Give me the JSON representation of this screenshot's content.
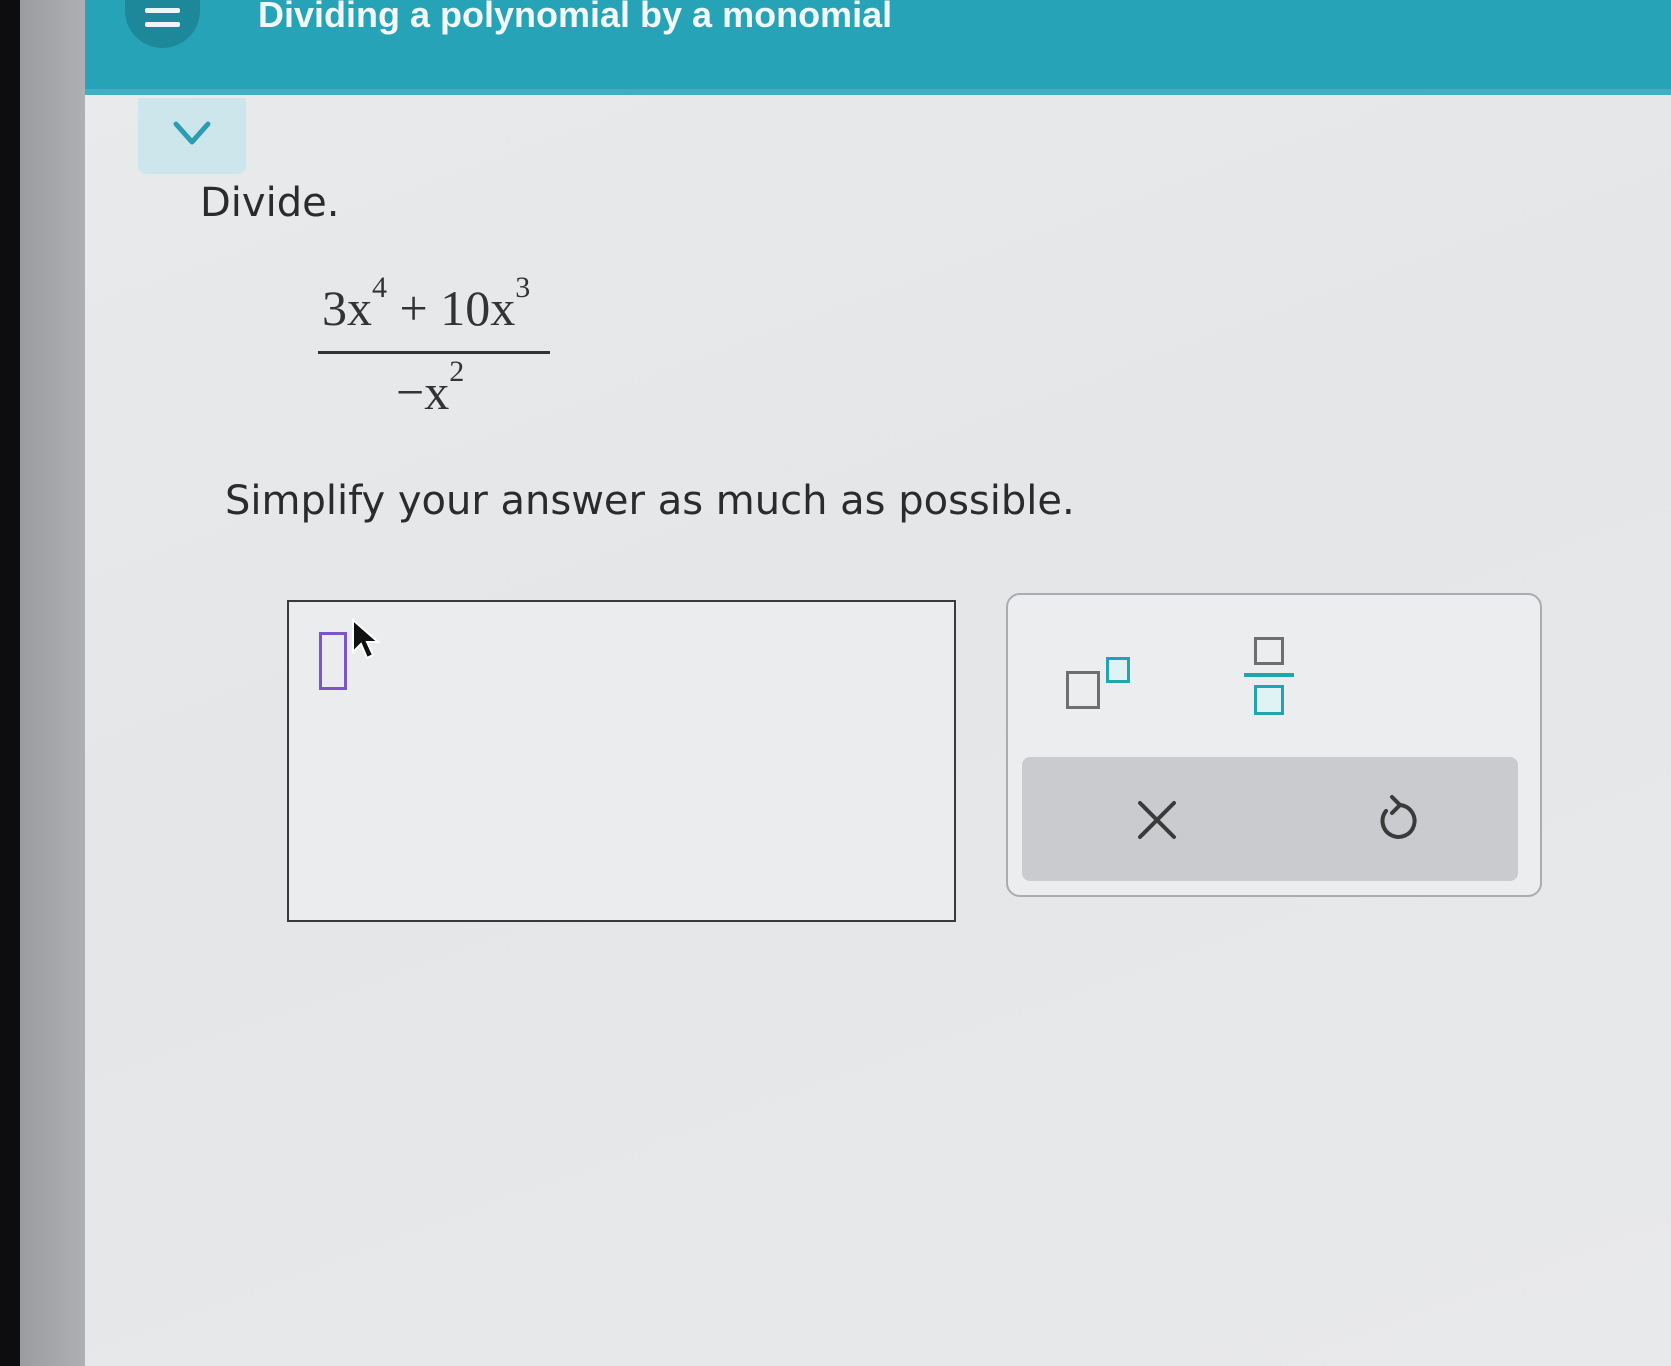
{
  "header": {
    "title": "Dividing a polynomial by a monomial"
  },
  "question": {
    "prompt": "Divide.",
    "expression": {
      "numerator": {
        "term1_coef": "3x",
        "term1_exp": "4",
        "operator": " + ",
        "term2_coef": "10x",
        "term2_exp": "3"
      },
      "denominator": {
        "base": "−x",
        "exp": "2"
      }
    },
    "instruction": "Simplify your answer as much as possible."
  },
  "answer": {
    "value": ""
  },
  "keypad": {
    "buttons": [
      "exponent",
      "fraction"
    ],
    "actions": [
      "clear",
      "undo"
    ]
  },
  "colors": {
    "header": "#27a3b8",
    "accent": "#21a3b2",
    "cursor": "#7b55c9"
  }
}
